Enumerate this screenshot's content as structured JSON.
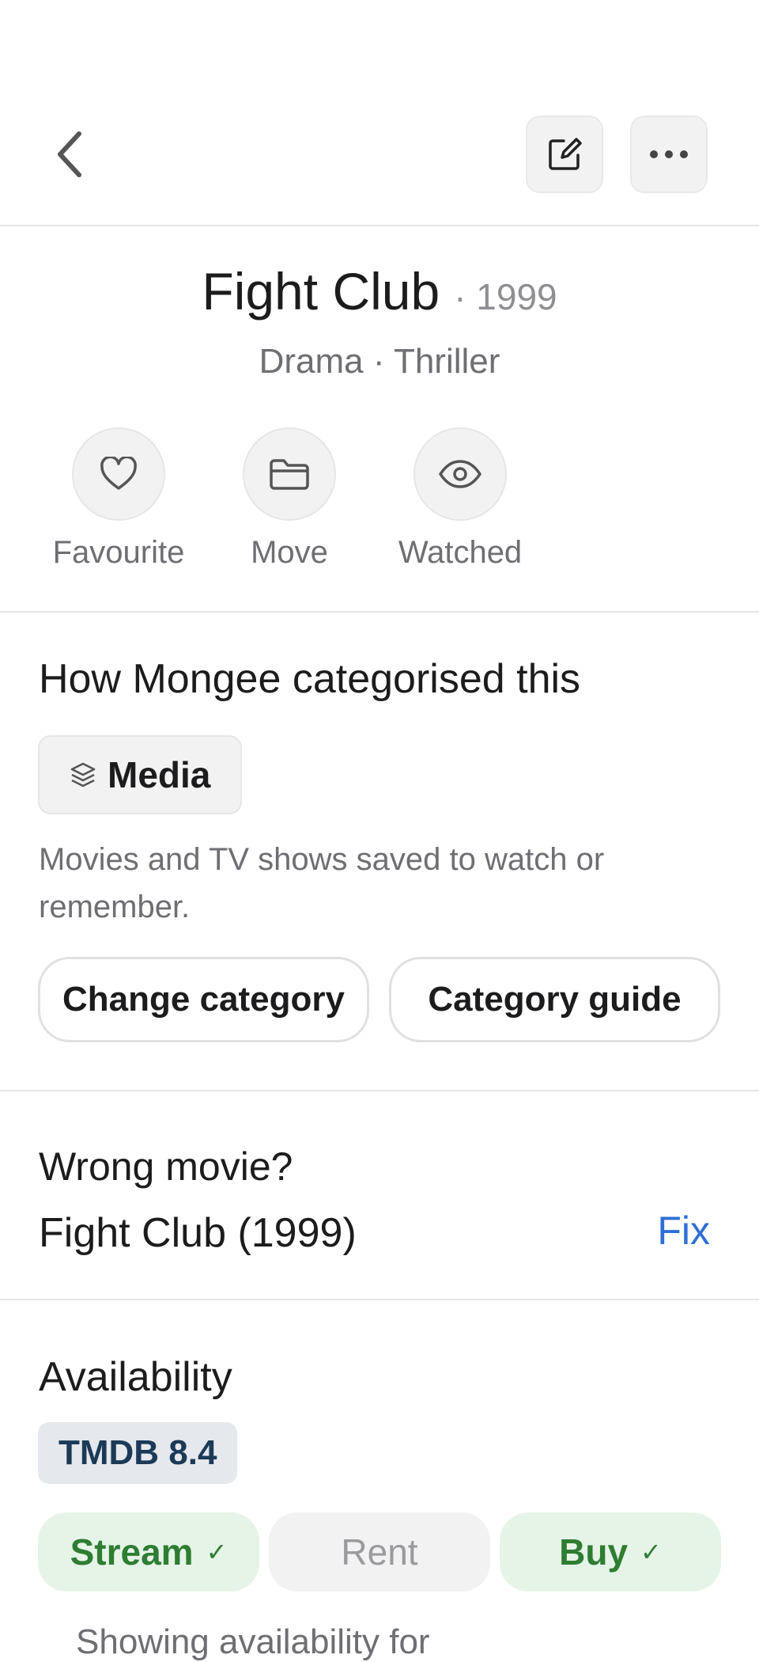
{
  "header": {
    "back_icon": "chevron-left-icon",
    "edit_icon": "edit-icon",
    "more_icon": "more-icon"
  },
  "movie": {
    "title": "Fight Club",
    "year": "· 1999",
    "genres": "Drama · Thriller"
  },
  "actions": [
    {
      "label": "Favourite",
      "icon": "heart-icon"
    },
    {
      "label": "Move",
      "icon": "folder-icon"
    },
    {
      "label": "Watched",
      "icon": "eye-icon"
    }
  ],
  "category": {
    "heading": "How Mongee categorised this",
    "chip_label": "Media",
    "chip_icon": "layers-icon",
    "description": "Movies and TV shows saved to watch or remember.",
    "change_label": "Change category",
    "guide_label": "Category guide"
  },
  "match": {
    "question": "Wrong movie?",
    "current": "Fight Club (1999)",
    "fix_label": "Fix"
  },
  "availability": {
    "heading": "Availability",
    "rating": "TMDB 8.4",
    "options": [
      {
        "label": "Stream",
        "available": true
      },
      {
        "label": "Rent",
        "available": false
      },
      {
        "label": "Buy",
        "available": true
      }
    ],
    "note": "Showing availability for"
  },
  "colors": {
    "accent_link": "#2f6fd6",
    "available_green": "#2e7d32",
    "available_bg": "#e6f4e8"
  }
}
